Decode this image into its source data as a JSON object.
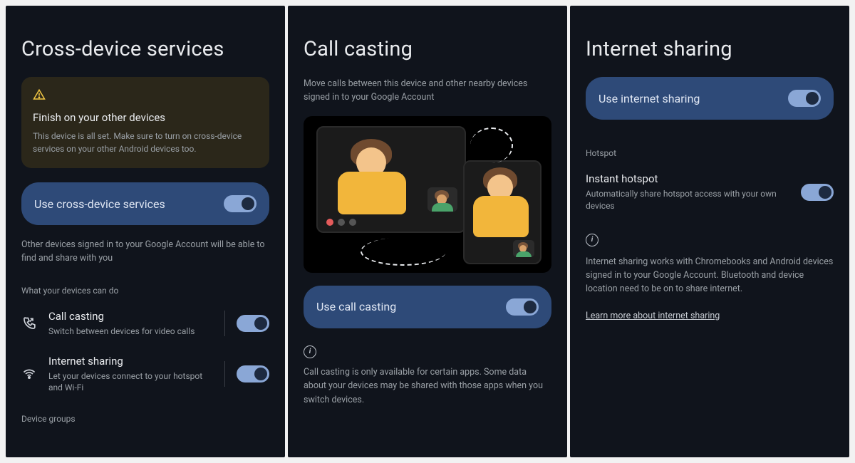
{
  "panel1": {
    "title": "Cross-device services",
    "notice_title": "Finish on your other devices",
    "notice_body": "This device is all set. Make sure to turn on cross-device services on your other Android devices too.",
    "toggle_label": "Use cross-device services",
    "desc_below_toggle": "Other devices signed in to your Google Account will be able to find and share with you",
    "section_label": "What your devices can do",
    "row1_title": "Call casting",
    "row1_sub": "Switch between devices for video calls",
    "row2_title": "Internet sharing",
    "row2_sub": "Let your devices connect to your hotspot and Wi-Fi",
    "footer_section": "Device groups"
  },
  "panel2": {
    "title": "Call casting",
    "desc": "Move calls between this device and other nearby devices signed in to your Google Account",
    "toggle_label": "Use call casting",
    "info_text": "Call casting is only available for certain apps. Some data about your devices may be shared with those apps when you switch devices."
  },
  "panel3": {
    "title": "Internet sharing",
    "toggle_label": "Use internet sharing",
    "section_label": "Hotspot",
    "row1_title": "Instant hotspot",
    "row1_sub": "Automatically share hotspot access with your own devices",
    "info_text": "Internet sharing works with Chromebooks and Android devices signed in to your Google Account. Bluetooth and device location need to be on to share internet.",
    "link_label": "Learn more about internet sharing"
  }
}
